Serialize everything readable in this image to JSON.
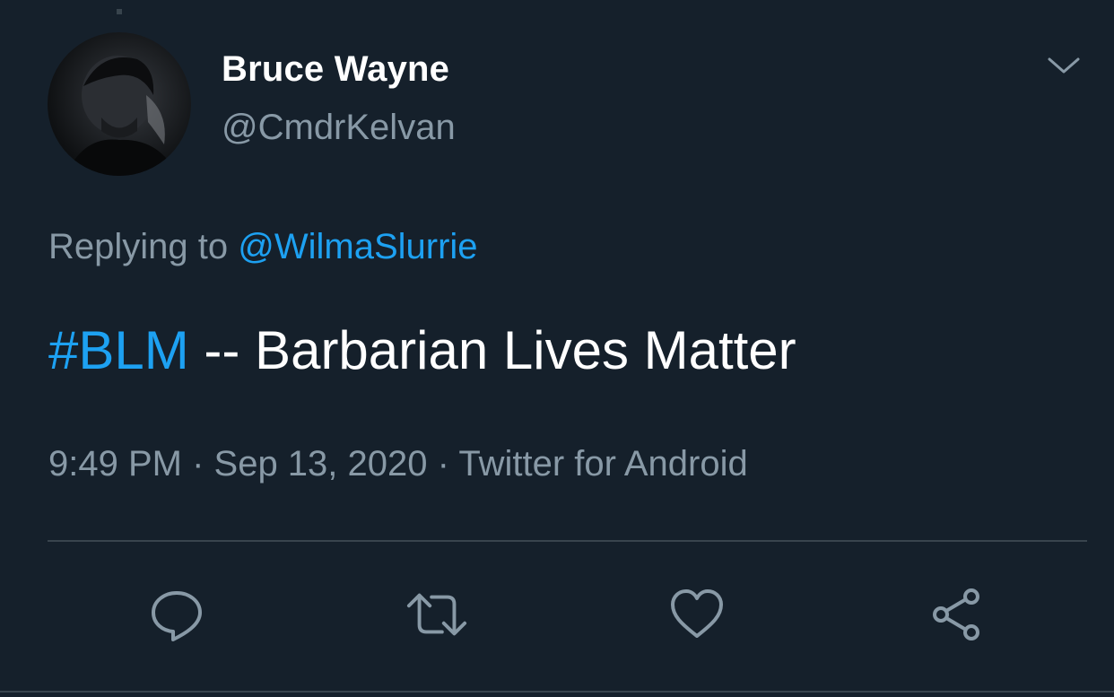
{
  "tweet": {
    "author": {
      "display_name": "Bruce Wayne",
      "handle": "@CmdrKelvan",
      "avatar_icon": "avatar-photo"
    },
    "reply": {
      "prefix": "Replying to",
      "to": "@WilmaSlurrie"
    },
    "text": {
      "hashtag": "#BLM",
      "body": " -- Barbarian Lives Matter"
    },
    "meta": {
      "time": "9:49 PM",
      "sep1": " · ",
      "date": "Sep 13, 2020",
      "sep2": " · ",
      "source": "Twitter for Android"
    },
    "actions": [
      {
        "name": "reply",
        "icon": "comment-icon"
      },
      {
        "name": "retweet",
        "icon": "retweet-icon"
      },
      {
        "name": "like",
        "icon": "heart-icon"
      },
      {
        "name": "share",
        "icon": "share-icon"
      }
    ],
    "menu_icon": "chevron-down-icon"
  },
  "colors": {
    "background": "#15202b",
    "primary_text": "#ffffff",
    "secondary_text": "#8899a6",
    "link": "#1da1f2",
    "divider": "#38444d"
  }
}
